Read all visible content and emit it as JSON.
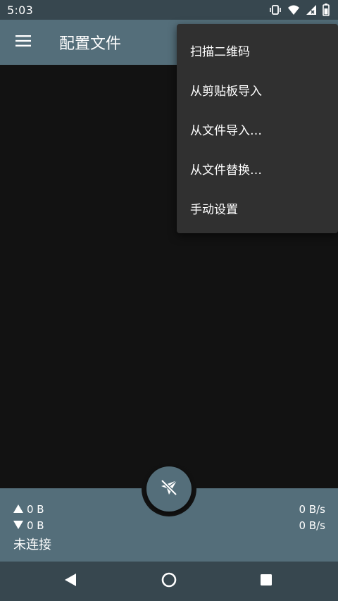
{
  "status_bar": {
    "time": "5:03",
    "icons": [
      "vibrate-icon",
      "wifi-icon",
      "signal-no-data-icon",
      "battery-icon"
    ]
  },
  "app_bar": {
    "title": "配置文件",
    "menu_icon": "hamburger-menu-icon"
  },
  "overflow_menu": {
    "items": [
      {
        "label": "扫描二维码"
      },
      {
        "label": "从剪贴板导入"
      },
      {
        "label": "从文件导入…"
      },
      {
        "label": "从文件替换…"
      },
      {
        "label": "手动设置"
      }
    ]
  },
  "traffic": {
    "upload_total": "0 B",
    "download_total": "0 B",
    "upload_rate": "0 B/s",
    "download_rate": "0 B/s",
    "connection_status": "未连接"
  },
  "fab": {
    "icon": "paper-plane-off-icon"
  },
  "nav_bar": {
    "icons": [
      "back-icon",
      "home-icon",
      "recents-icon"
    ]
  },
  "colors": {
    "primary": "#546e7a",
    "primary_dark": "#37474f",
    "background": "#121212",
    "menu_background": "#303030",
    "text": "#ffffff"
  }
}
